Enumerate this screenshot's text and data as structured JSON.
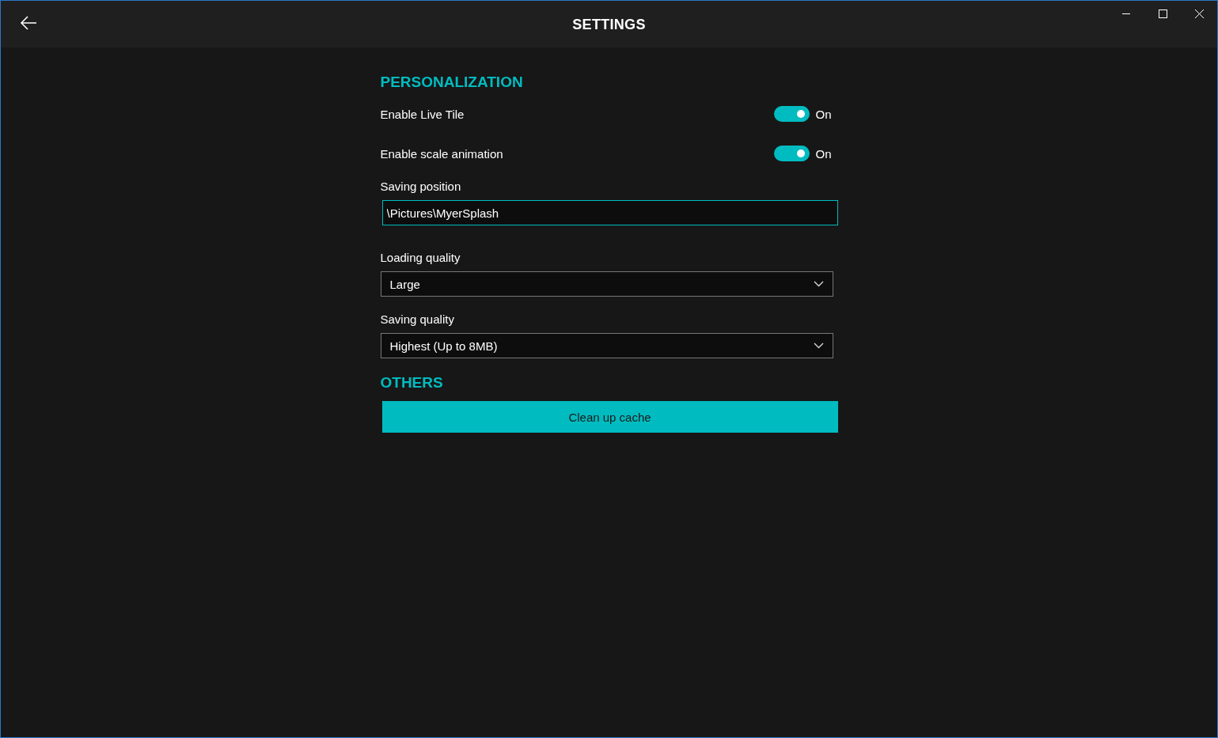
{
  "window": {
    "title": "SETTINGS"
  },
  "sections": [
    {
      "heading": "PERSONALIZATION",
      "items": [
        {
          "kind": "toggle",
          "label": "Enable Live Tile",
          "on": true,
          "state_text": "On"
        },
        {
          "kind": "toggle",
          "label": "Enable scale animation",
          "on": true,
          "state_text": "On"
        },
        {
          "kind": "text",
          "label": "Saving position",
          "value": "\\Pictures\\MyerSplash"
        },
        {
          "kind": "dropdown",
          "label": "Loading quality",
          "value": "Large"
        },
        {
          "kind": "dropdown",
          "label": "Saving quality",
          "value": "Highest (Up to 8MB)"
        }
      ]
    },
    {
      "heading": "OTHERS",
      "items": [
        {
          "kind": "button",
          "label": "Clean up cache"
        }
      ]
    }
  ]
}
